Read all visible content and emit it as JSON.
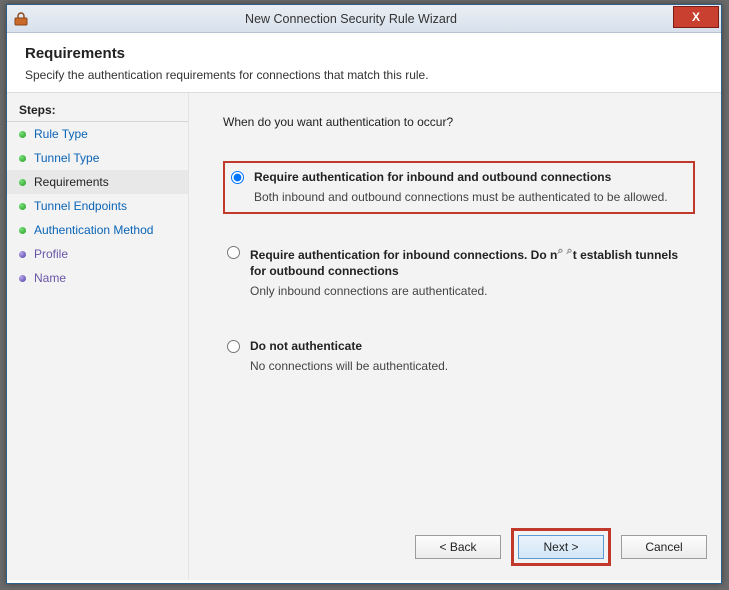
{
  "window": {
    "title": "New Connection Security Rule Wizard",
    "close": "X"
  },
  "header": {
    "title": "Requirements",
    "subtitle": "Specify the authentication requirements for connections that match this rule."
  },
  "steps": {
    "header": "Steps:",
    "items": [
      {
        "label": "Rule Type",
        "current": false,
        "bullet": "green"
      },
      {
        "label": "Tunnel Type",
        "current": false,
        "bullet": "green"
      },
      {
        "label": "Requirements",
        "current": true,
        "bullet": "green"
      },
      {
        "label": "Tunnel Endpoints",
        "current": false,
        "bullet": "green"
      },
      {
        "label": "Authentication Method",
        "current": false,
        "bullet": "green"
      },
      {
        "label": "Profile",
        "current": false,
        "bullet": "violet"
      },
      {
        "label": "Name",
        "current": false,
        "bullet": "violet"
      }
    ]
  },
  "content": {
    "question": "When do you want authentication to occur?",
    "options": [
      {
        "title": "Require authentication for inbound and outbound connections",
        "desc": "Both inbound and outbound connections must be authenticated to be allowed.",
        "selected": true,
        "highlight": true
      },
      {
        "title_part1": "Require authentication for inbound connections. Do n",
        "title_part2": "t establish tunnels for outbound connections",
        "desc": "Only inbound connections are authenticated.",
        "selected": false,
        "highlight": false,
        "has_magnify": true
      },
      {
        "title": "Do not authenticate",
        "desc": "No connections will be authenticated.",
        "selected": false,
        "highlight": false
      }
    ]
  },
  "buttons": {
    "back": "< Back",
    "next": "Next >",
    "cancel": "Cancel"
  }
}
